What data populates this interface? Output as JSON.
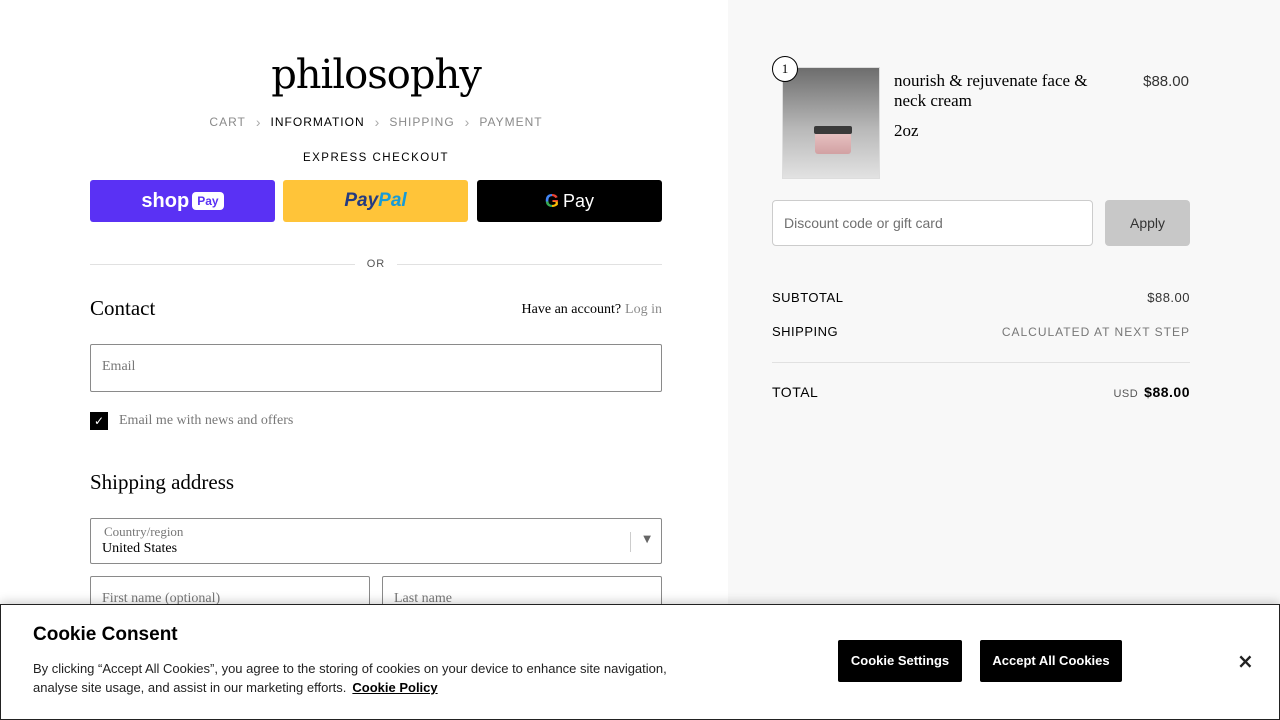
{
  "brand": {
    "logo_text": "philosophy"
  },
  "breadcrumb": [
    {
      "label": "CART"
    },
    {
      "label": "INFORMATION"
    },
    {
      "label": "SHIPPING"
    },
    {
      "label": "PAYMENT"
    }
  ],
  "express": {
    "title": "EXPRESS CHECKOUT",
    "shop_label": "shop",
    "shop_pay_label": "Pay",
    "paypal_label_1": "Pay",
    "paypal_label_2": "Pal",
    "gpay_g": "G",
    "gpay_label": "Pay",
    "or_label": "OR"
  },
  "contact": {
    "title": "Contact",
    "account_prompt": "Have an account?",
    "login_label": "Log in",
    "email_placeholder": "Email",
    "newsletter_checked": true,
    "newsletter_label": "Email me with news and offers"
  },
  "shipping_address": {
    "title": "Shipping address",
    "country_label": "Country/region",
    "country_value": "United States",
    "first_name_placeholder": "First name (optional)",
    "last_name_placeholder": "Last name"
  },
  "order": {
    "item": {
      "quantity": "1",
      "name": "nourish & rejuvenate face & neck cream",
      "size": "2oz",
      "price": "$88.00"
    },
    "discount_placeholder": "Discount code or gift card",
    "apply_label": "Apply",
    "subtotal_label": "SUBTOTAL",
    "subtotal_value": "$88.00",
    "shipping_label": "SHIPPING",
    "shipping_value": "CALCULATED AT NEXT STEP",
    "total_label": "TOTAL",
    "total_currency": "USD",
    "total_value": "$88.00"
  },
  "cookie": {
    "title": "Cookie Consent",
    "body": "By clicking “Accept All Cookies”, you agree to the storing of cookies on your device to enhance site navigation, analyse site usage, and assist in our marketing efforts.",
    "policy_link": "Cookie Policy",
    "settings_label": "Cookie Settings",
    "accept_label": "Accept All Cookies",
    "close_glyph": "×"
  }
}
